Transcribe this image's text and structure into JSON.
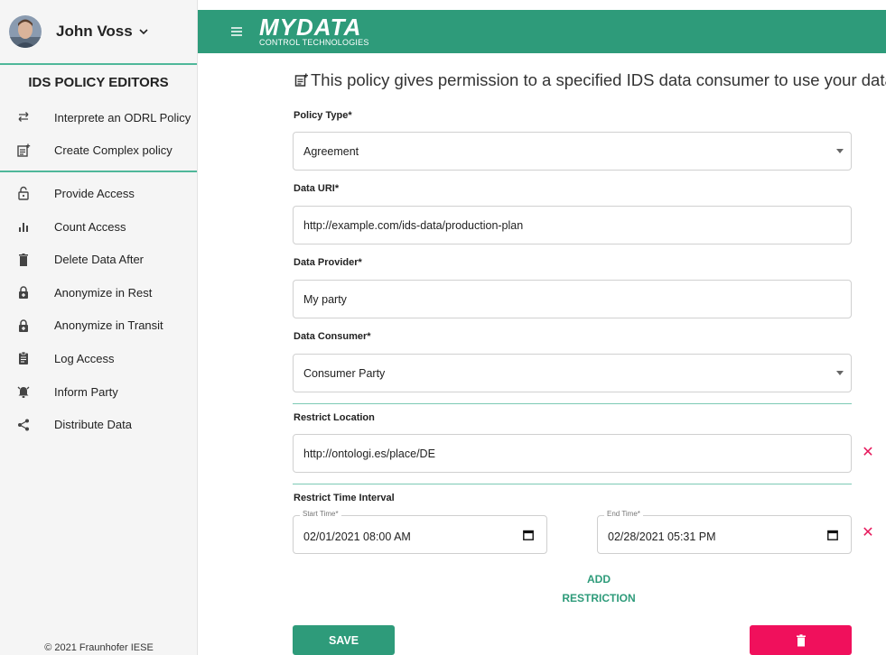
{
  "user": {
    "name": "John Voss"
  },
  "sidebar": {
    "title": "IDS POLICY EDITORS",
    "editors": [
      {
        "label": "Interprete an ODRL Policy",
        "icon": "swap-arrows-icon"
      },
      {
        "label": "Create Complex policy",
        "icon": "note-add-icon"
      }
    ],
    "policies": [
      {
        "label": "Provide Access",
        "icon": "lock-open-icon"
      },
      {
        "label": "Count Access",
        "icon": "bar-chart-icon"
      },
      {
        "label": "Delete Data After",
        "icon": "trash-icon"
      },
      {
        "label": "Anonymize in Rest",
        "icon": "lock-plus-icon"
      },
      {
        "label": "Anonymize in Transit",
        "icon": "lock-plus-icon"
      },
      {
        "label": "Log Access",
        "icon": "clipboard-icon"
      },
      {
        "label": "Inform Party",
        "icon": "alarm-icon"
      },
      {
        "label": "Distribute Data",
        "icon": "share-icon"
      }
    ],
    "copyright": "© 2021 Fraunhofer IESE"
  },
  "topbar": {
    "logo_main": "MYDATA",
    "logo_sub": "CONTROL TECHNOLOGIES"
  },
  "form": {
    "headline": "This policy gives permission to a specified IDS data consumer to use your data",
    "policy_type_label": "Policy Type*",
    "policy_type_value": "Agreement",
    "data_uri_label": "Data URI*",
    "data_uri_value": "http://example.com/ids-data/production-plan",
    "data_provider_label": "Data Provider*",
    "data_provider_value": "My party",
    "data_consumer_label": "Data Consumer*",
    "data_consumer_value": "Consumer Party",
    "restrict_location_label": "Restrict Location",
    "restrict_location_value": "http://ontologi.es/place/DE",
    "restrict_time_label": "Restrict Time Interval",
    "start_time_label": "Start Time*",
    "start_time_value": "02/01/2021 08:00 AM",
    "end_time_label": "End Time*",
    "end_time_value": "02/28/2021 05:31 PM",
    "add_restriction_line1": "ADD",
    "add_restriction_line2": "RESTRICTION",
    "save_label": "SAVE",
    "remove_symbol": "✕"
  },
  "colors": {
    "primary": "#2e9b7a",
    "danger": "#f0105c",
    "accent_line": "#4fb79a"
  }
}
